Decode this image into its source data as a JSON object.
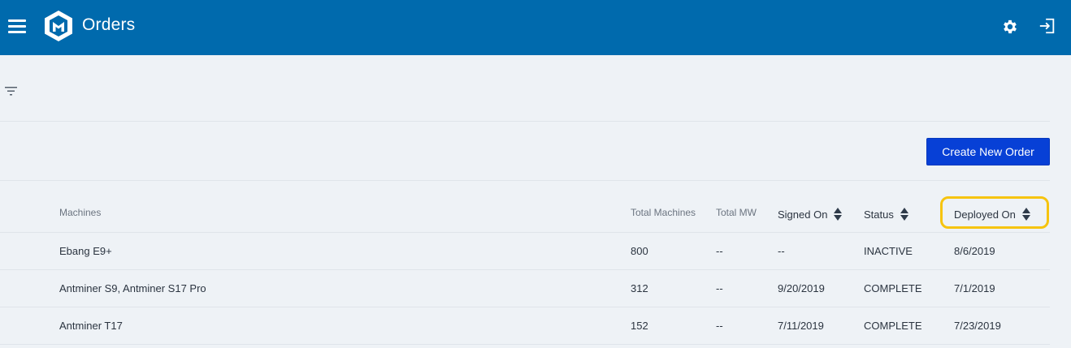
{
  "header": {
    "title": "Orders",
    "background_color": "#006aad",
    "icons": [
      "menu-icon",
      "logo-icon",
      "gear-icon",
      "logout-icon"
    ]
  },
  "toolbar": {
    "filter_icon": "filter-icon",
    "create_button_label": "Create New Order",
    "create_button_color": "#0740d6"
  },
  "table": {
    "columns": {
      "machines": "Machines",
      "total_machines": "Total Machines",
      "total_mw": "Total MW",
      "signed_on": "Signed On",
      "status": "Status",
      "deployed_on": "Deployed On"
    },
    "highlight_color": "#f6c40f",
    "rows": [
      {
        "machines": "Ebang E9+",
        "total_machines": "800",
        "total_mw": "--",
        "signed_on": "--",
        "status": "INACTIVE",
        "deployed_on": "8/6/2019"
      },
      {
        "machines": "Antminer S9, Antminer S17 Pro",
        "total_machines": "312",
        "total_mw": "--",
        "signed_on": "9/20/2019",
        "status": "COMPLETE",
        "deployed_on": "7/1/2019"
      },
      {
        "machines": "Antminer T17",
        "total_machines": "152",
        "total_mw": "--",
        "signed_on": "7/11/2019",
        "status": "COMPLETE",
        "deployed_on": "7/23/2019"
      }
    ]
  }
}
